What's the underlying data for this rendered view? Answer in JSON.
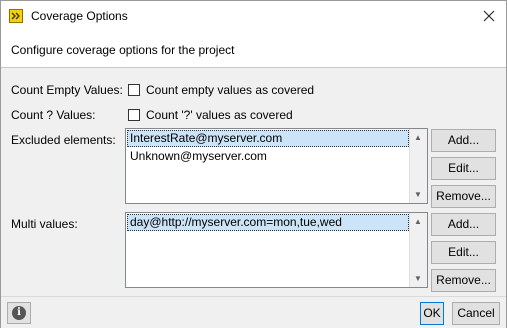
{
  "window": {
    "title": "Coverage Options"
  },
  "header": {
    "description": "Configure coverage options for the project"
  },
  "options": {
    "count_empty": {
      "label": "Count Empty Values:",
      "checkbox_label": "Count empty values as covered",
      "checked": false
    },
    "count_unknown": {
      "label": "Count ? Values:",
      "checkbox_label": "Count '?' values as covered",
      "checked": false
    }
  },
  "excluded": {
    "label": "Excluded elements:",
    "items": [
      "InterestRate@myserver.com",
      "Unknown@myserver.com"
    ],
    "selected_index": 0,
    "buttons": {
      "add": "Add...",
      "edit": "Edit...",
      "remove": "Remove..."
    }
  },
  "multi": {
    "label": "Multi values:",
    "items": [
      "day@http://myserver.com=mon,tue,wed"
    ],
    "selected_index": 0,
    "buttons": {
      "add": "Add...",
      "edit": "Edit...",
      "remove": "Remove..."
    }
  },
  "footer": {
    "info_icon": "i",
    "ok": "OK",
    "cancel": "Cancel"
  }
}
